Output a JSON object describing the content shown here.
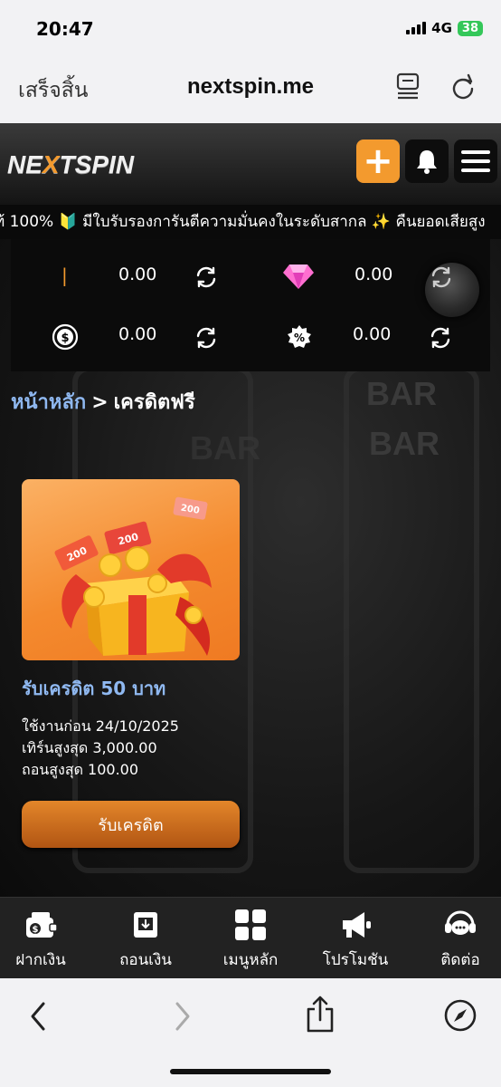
{
  "status_bar": {
    "time": "20:47",
    "network": "4G",
    "battery": "38"
  },
  "browser": {
    "done_label": "เสร็จสิ้น",
    "url": "nextspin.me"
  },
  "header": {
    "logo_prefix": "NE",
    "logo_x": "X",
    "logo_suffix": "TSPIN",
    "plus_label": "+"
  },
  "marquee": {
    "text": "ท้ 100% 🔰 มีใบรับรองการันตีความมั่นคงในระดับสากล ✨ คืนยอดเสียสูง"
  },
  "balance": {
    "top_left_marker": "|",
    "values": [
      "0.00",
      "0.00",
      "0.00",
      "0.00"
    ]
  },
  "breadcrumb": {
    "home": "หน้าหลัก",
    "separator": ">",
    "current": "เครดิตฟรี"
  },
  "promo": {
    "title": "รับเครดิต 50 บาท",
    "expiry": "ใช้งานก่อน 24/10/2025",
    "max_turnover": "เทิร์นสูงสุด 3,000.00",
    "max_withdraw": "ถอนสูงสุด 100.00",
    "button": "รับเครดิต",
    "ticket_a": "200",
    "ticket_b": "200",
    "ticket_c": "200"
  },
  "bottom_nav": [
    {
      "label": "ฝากเงิน",
      "icon": "deposit-icon"
    },
    {
      "label": "ถอนเงิน",
      "icon": "withdraw-icon"
    },
    {
      "label": "เมนูหลัก",
      "icon": "grid-icon"
    },
    {
      "label": "โปรโมชัน",
      "icon": "megaphone-icon"
    },
    {
      "label": "ติดต่อ",
      "icon": "support-icon"
    }
  ],
  "colors": {
    "accent": "#f39a2e",
    "link": "#8fb8f0",
    "background": "#161616"
  }
}
